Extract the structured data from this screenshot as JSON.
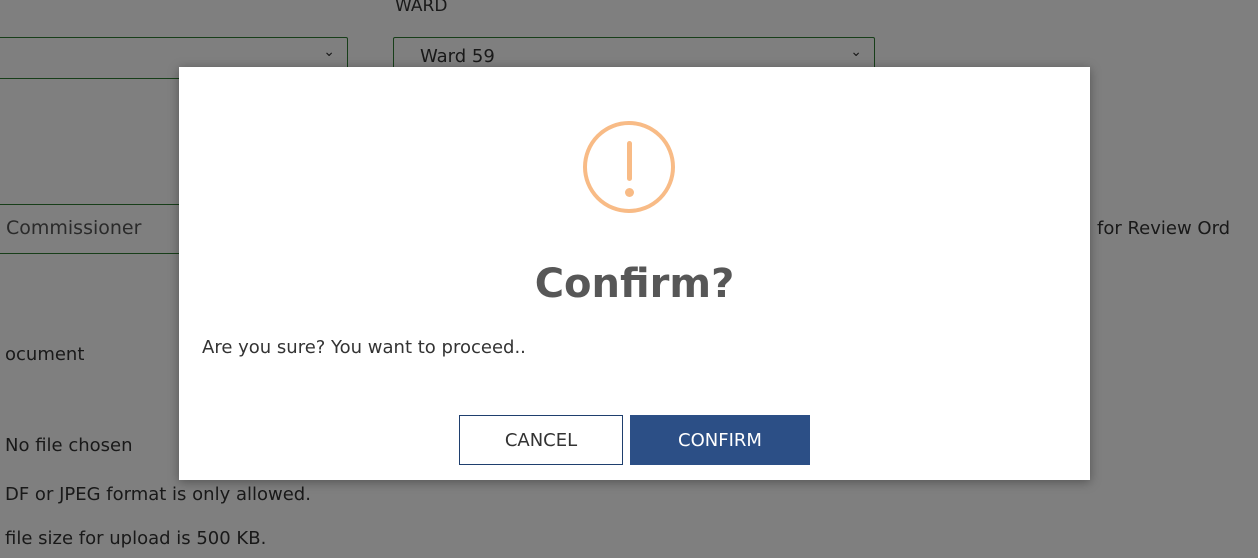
{
  "background_form": {
    "ward_label": "WARD",
    "ward_select_value": "Ward 59",
    "left_select_value": "",
    "designation_field": "Commissioner",
    "side_text": "for Review Ord",
    "document_label": "ocument",
    "file_status": "No file chosen",
    "format_note": "DF or JPEG format is only allowed.",
    "size_note": "file size for upload is 500 KB."
  },
  "dialog": {
    "icon": "warning-exclamation-icon",
    "icon_color": "#f8bb86",
    "title": "Confirm?",
    "message": "Are you sure? You want to proceed..",
    "cancel_label": "CANCEL",
    "confirm_label": "CONFIRM",
    "confirm_color": "#2c4f86"
  }
}
